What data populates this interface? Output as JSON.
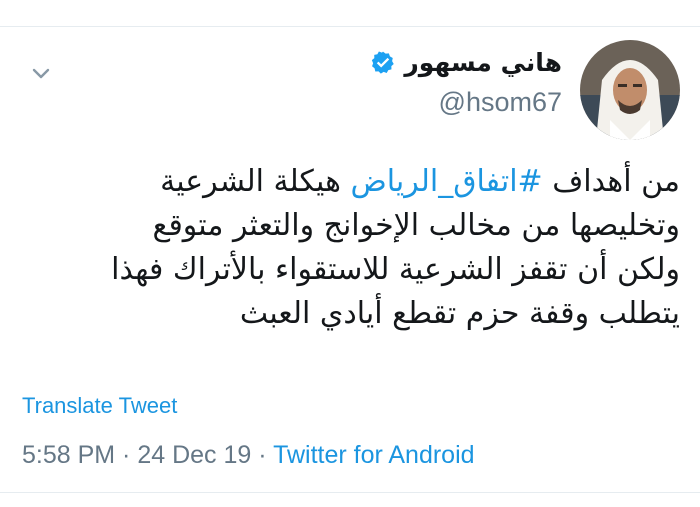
{
  "user": {
    "display_name": "هاني مسهور",
    "handle": "@hsom67",
    "verified_icon": "verified-badge-icon",
    "menu_icon": "chevron-down-icon"
  },
  "tweet": {
    "line1_prefix": "من أهداف ",
    "hashtag": "#اتفاق_الرياض",
    "line1_suffix": " هيكلة الشرعية",
    "line2": "وتخليصها من مخالب الإخوانج والتعثر متوقع",
    "line3": "ولكن أن تقفز الشرعية للاستقواء بالأتراك فهذا",
    "line4": "يتطلب وقفة حزم تقطع أيادي العبث"
  },
  "translate_label": "Translate Tweet",
  "meta": {
    "time": "5:58 PM",
    "separator": " · ",
    "date": "24 Dec 19",
    "source": "Twitter for Android"
  },
  "colors": {
    "link": "#1b95e0",
    "text": "#14171a",
    "secondary": "#657786",
    "verified": "#1da1f2"
  }
}
